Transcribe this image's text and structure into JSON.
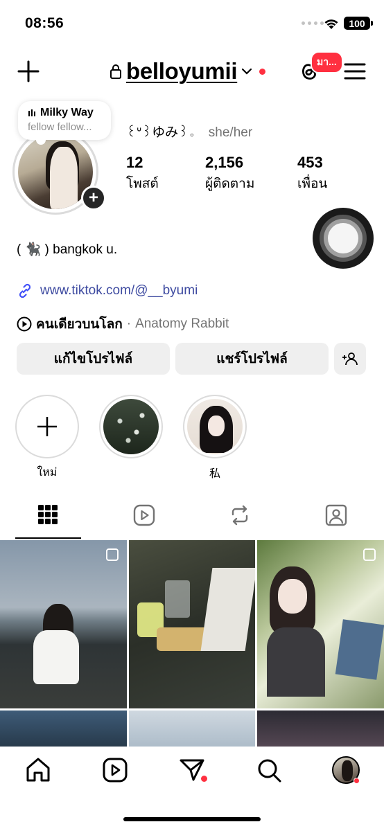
{
  "status": {
    "time": "08:56",
    "battery": "100"
  },
  "topnav": {
    "username": "belloyumii",
    "notification_badge": "มา...",
    "accent_color": "#ff3040"
  },
  "note": {
    "title": "Milky Way",
    "subtitle": "fellow fellow..."
  },
  "profile": {
    "display_name": "꒰ᐡ꒱ゆみ꒱。",
    "pronouns": "she/her",
    "stats": [
      {
        "value": "12",
        "label": "โพสต์"
      },
      {
        "value": "2,156",
        "label": "ผู้ติดตาม"
      },
      {
        "value": "453",
        "label": "เพื่อน"
      }
    ],
    "bio": "( 🐈‍⬛ ) bangkok u.",
    "link": "www.tiktok.com/@__byumi",
    "music": {
      "song": "คนเดียวบนโลก",
      "separator": "·",
      "artist": "Anatomy Rabbit"
    }
  },
  "buttons": {
    "edit": "แก้ไขโปรไฟล์",
    "share": "แชร์โปรไฟล์"
  },
  "highlights": [
    {
      "label": "ใหม่"
    },
    {
      "label": ""
    },
    {
      "label": "私"
    }
  ],
  "tabs": [
    "grid-icon",
    "reels-icon",
    "reposts-icon",
    "tagged-icon"
  ],
  "bottom_nav": [
    "home-icon",
    "reels-icon",
    "send-icon",
    "search-icon",
    "profile-avatar"
  ]
}
